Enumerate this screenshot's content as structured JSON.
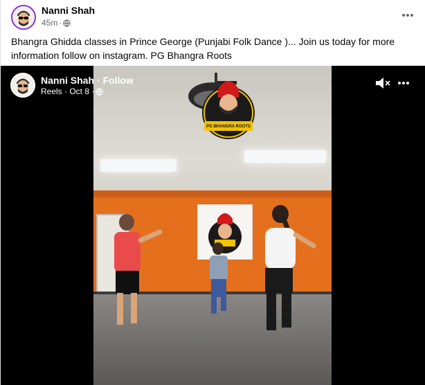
{
  "post": {
    "author": "Nanni Shah",
    "time": "45m",
    "dot": "·",
    "caption": "Bhangra Ghidda classes in Prince George (Punjabi Folk Dance )... Join us today for more information follow on instagram. PG Bhangra Roots"
  },
  "video": {
    "author_follow": "Nanni Shah · Follow",
    "meta": "Reels · Oct 8 ·",
    "logo_text": "PG BHANGRA ROOTS"
  },
  "colors": {
    "avatar_ring": "#8a2be2",
    "text_primary": "#050505",
    "text_secondary": "#65676b",
    "wall_orange": "#e4701d"
  },
  "icons": {
    "globe": "globe-icon",
    "more": "more-horizontal-icon",
    "mute": "speaker-muted-icon"
  }
}
